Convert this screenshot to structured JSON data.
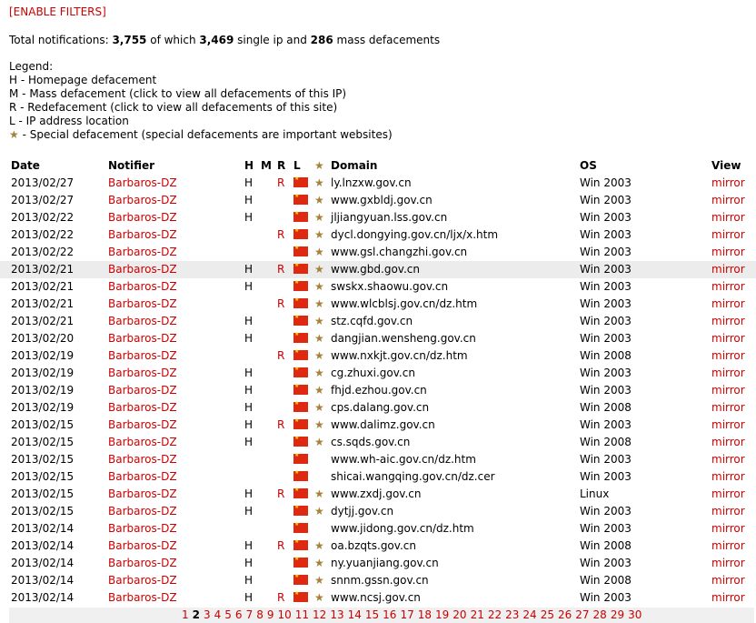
{
  "filters_link": "[ENABLE FILTERS]",
  "totals": {
    "prefix": "Total notifications: ",
    "total": "3,755",
    "mid1": " of which ",
    "single": "3,469",
    "mid2": " single ip and ",
    "mass": "286",
    "suffix": " mass defacements"
  },
  "legend": {
    "title": "Legend:",
    "h": "H - Homepage defacement",
    "m": "M - Mass defacement (click to view all defacements of this IP)",
    "r": "R - Redefacement (click to view all defacements of this site)",
    "l": "L - IP address location",
    "special": " - Special defacement (special defacements are important websites)"
  },
  "table": {
    "headers": {
      "date": "Date",
      "notifier": "Notifier",
      "h": "H",
      "m": "M",
      "r": "R",
      "l": "L",
      "domain": "Domain",
      "os": "OS",
      "view": "View"
    },
    "rows": [
      {
        "date": "2013/02/27",
        "notifier": "Barbaros-DZ",
        "h": "H",
        "m": "",
        "r": "R",
        "domain": "ly.lnzxw.gov.cn",
        "os": "Win 2003",
        "view": "mirror",
        "star": true
      },
      {
        "date": "2013/02/27",
        "notifier": "Barbaros-DZ",
        "h": "H",
        "m": "",
        "r": "",
        "domain": "www.gxbldj.gov.cn",
        "os": "Win 2003",
        "view": "mirror",
        "star": true
      },
      {
        "date": "2013/02/22",
        "notifier": "Barbaros-DZ",
        "h": "H",
        "m": "",
        "r": "",
        "domain": "jljiangyuan.lss.gov.cn",
        "os": "Win 2003",
        "view": "mirror",
        "star": true
      },
      {
        "date": "2013/02/22",
        "notifier": "Barbaros-DZ",
        "h": "",
        "m": "",
        "r": "R",
        "domain": "dycl.dongying.gov.cn/ljx/x.htm",
        "os": "Win 2003",
        "view": "mirror",
        "star": true
      },
      {
        "date": "2013/02/22",
        "notifier": "Barbaros-DZ",
        "h": "",
        "m": "",
        "r": "",
        "domain": "www.gsl.changzhi.gov.cn",
        "os": "Win 2003",
        "view": "mirror",
        "star": true
      },
      {
        "date": "2013/02/21",
        "notifier": "Barbaros-DZ",
        "h": "H",
        "m": "",
        "r": "R",
        "domain": "www.gbd.gov.cn",
        "os": "Win 2003",
        "view": "mirror",
        "star": true
      },
      {
        "date": "2013/02/21",
        "notifier": "Barbaros-DZ",
        "h": "H",
        "m": "",
        "r": "",
        "domain": "swskx.shaowu.gov.cn",
        "os": "Win 2003",
        "view": "mirror",
        "star": true
      },
      {
        "date": "2013/02/21",
        "notifier": "Barbaros-DZ",
        "h": "",
        "m": "",
        "r": "R",
        "domain": "www.wlcblsj.gov.cn/dz.htm",
        "os": "Win 2003",
        "view": "mirror",
        "star": true
      },
      {
        "date": "2013/02/21",
        "notifier": "Barbaros-DZ",
        "h": "H",
        "m": "",
        "r": "",
        "domain": "stz.cqfd.gov.cn",
        "os": "Win 2003",
        "view": "mirror",
        "star": true
      },
      {
        "date": "2013/02/20",
        "notifier": "Barbaros-DZ",
        "h": "H",
        "m": "",
        "r": "",
        "domain": "dangjian.wensheng.gov.cn",
        "os": "Win 2003",
        "view": "mirror",
        "star": true
      },
      {
        "date": "2013/02/19",
        "notifier": "Barbaros-DZ",
        "h": "",
        "m": "",
        "r": "R",
        "domain": "www.nxkjt.gov.cn/dz.htm",
        "os": "Win 2008",
        "view": "mirror",
        "star": true
      },
      {
        "date": "2013/02/19",
        "notifier": "Barbaros-DZ",
        "h": "H",
        "m": "",
        "r": "",
        "domain": "cg.zhuxi.gov.cn",
        "os": "Win 2003",
        "view": "mirror",
        "star": true
      },
      {
        "date": "2013/02/19",
        "notifier": "Barbaros-DZ",
        "h": "H",
        "m": "",
        "r": "",
        "domain": "fhjd.ezhou.gov.cn",
        "os": "Win 2003",
        "view": "mirror",
        "star": true
      },
      {
        "date": "2013/02/19",
        "notifier": "Barbaros-DZ",
        "h": "H",
        "m": "",
        "r": "",
        "domain": "cps.dalang.gov.cn",
        "os": "Win 2008",
        "view": "mirror",
        "star": true
      },
      {
        "date": "2013/02/15",
        "notifier": "Barbaros-DZ",
        "h": "H",
        "m": "",
        "r": "R",
        "domain": "www.dalimz.gov.cn",
        "os": "Win 2003",
        "view": "mirror",
        "star": true
      },
      {
        "date": "2013/02/15",
        "notifier": "Barbaros-DZ",
        "h": "H",
        "m": "",
        "r": "",
        "domain": "cs.sqds.gov.cn",
        "os": "Win 2008",
        "view": "mirror",
        "star": true
      },
      {
        "date": "2013/02/15",
        "notifier": "Barbaros-DZ",
        "h": "",
        "m": "",
        "r": "",
        "domain": "www.wh-aic.gov.cn/dz.htm",
        "os": "Win 2003",
        "view": "mirror",
        "star": false
      },
      {
        "date": "2013/02/15",
        "notifier": "Barbaros-DZ",
        "h": "",
        "m": "",
        "r": "",
        "domain": "shicai.wangqing.gov.cn/dz.cer",
        "os": "Win 2003",
        "view": "mirror",
        "star": false
      },
      {
        "date": "2013/02/15",
        "notifier": "Barbaros-DZ",
        "h": "H",
        "m": "",
        "r": "R",
        "domain": "www.zxdj.gov.cn",
        "os": "Linux",
        "view": "mirror",
        "star": true
      },
      {
        "date": "2013/02/15",
        "notifier": "Barbaros-DZ",
        "h": "H",
        "m": "",
        "r": "",
        "domain": "dytjj.gov.cn",
        "os": "Win 2003",
        "view": "mirror",
        "star": true
      },
      {
        "date": "2013/02/14",
        "notifier": "Barbaros-DZ",
        "h": "",
        "m": "",
        "r": "",
        "domain": "www.jidong.gov.cn/dz.htm",
        "os": "Win 2003",
        "view": "mirror",
        "star": false
      },
      {
        "date": "2013/02/14",
        "notifier": "Barbaros-DZ",
        "h": "H",
        "m": "",
        "r": "R",
        "domain": "oa.bzqts.gov.cn",
        "os": "Win 2008",
        "view": "mirror",
        "star": true
      },
      {
        "date": "2013/02/14",
        "notifier": "Barbaros-DZ",
        "h": "H",
        "m": "",
        "r": "",
        "domain": "ny.yuanjiang.gov.cn",
        "os": "Win 2003",
        "view": "mirror",
        "star": true
      },
      {
        "date": "2013/02/14",
        "notifier": "Barbaros-DZ",
        "h": "H",
        "m": "",
        "r": "",
        "domain": "snnm.gssn.gov.cn",
        "os": "Win 2008",
        "view": "mirror",
        "star": true
      },
      {
        "date": "2013/02/14",
        "notifier": "Barbaros-DZ",
        "h": "H",
        "m": "",
        "r": "R",
        "domain": "www.ncsj.gov.cn",
        "os": "Win 2003",
        "view": "mirror",
        "star": true
      }
    ]
  },
  "pagination": {
    "current": "2",
    "pages": [
      "1",
      "2",
      "3",
      "4",
      "5",
      "6",
      "7",
      "8",
      "9",
      "10",
      "11",
      "12",
      "13",
      "14",
      "15",
      "16",
      "17",
      "18",
      "19",
      "20",
      "21",
      "22",
      "23",
      "24",
      "25",
      "26",
      "27",
      "28",
      "29",
      "30"
    ]
  },
  "colors": {
    "link": "#cc0000",
    "star": "#a5813a",
    "highlight_row": "#ececec",
    "flag": "#de2910"
  },
  "icons": {
    "special": "star-icon",
    "location": "china-flag-icon"
  }
}
